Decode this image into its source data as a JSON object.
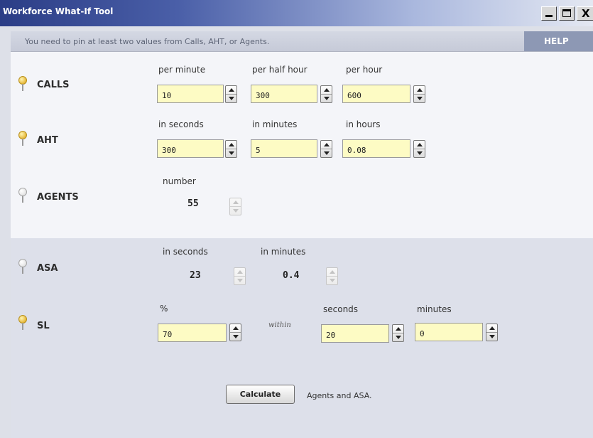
{
  "window": {
    "title": "Workforce What-If Tool",
    "close_glyph": "X"
  },
  "message": "You need to pin at least two values from Calls, AHT, or Agents.",
  "help_label": "HELP",
  "calls": {
    "label": "CALLS",
    "pinned": true,
    "captions": [
      "per minute",
      "per half hour",
      "per hour"
    ],
    "values": [
      "10",
      "300",
      "600"
    ]
  },
  "aht": {
    "label": "AHT",
    "pinned": true,
    "captions": [
      "in seconds",
      "in minutes",
      "in hours"
    ],
    "values": [
      "300",
      "5",
      "0.08"
    ]
  },
  "agents": {
    "label": "AGENTS",
    "pinned": false,
    "caption": "number",
    "value": "55"
  },
  "asa": {
    "label": "ASA",
    "pinned": false,
    "captions": [
      "in seconds",
      "in minutes"
    ],
    "values": [
      "23",
      "0.4"
    ]
  },
  "sl": {
    "label": "SL",
    "pinned": true,
    "captions": [
      "%",
      "seconds",
      "minutes"
    ],
    "within_text": "within",
    "values": [
      "70",
      "20",
      "0"
    ]
  },
  "calculate": {
    "button_label": "Calculate",
    "note": "Agents and ASA."
  },
  "colors": {
    "titlebar_start": "#2b3d86",
    "field_fill": "#fdfbc4",
    "pin_active": "#e6b73a",
    "help_bg": "#8d98b4"
  },
  "icons": {
    "pin_active": "pin-icon (yellow)",
    "pin_inactive": "pin-icon (gray)",
    "spinner": "up-down-arrows"
  }
}
